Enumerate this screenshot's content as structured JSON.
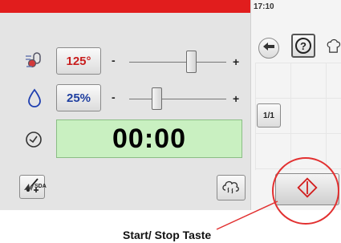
{
  "status_bar": {
    "time": "17:10"
  },
  "temperature": {
    "value": "125°",
    "minus": "-",
    "plus": "+",
    "slider_level": 0.66
  },
  "humidity": {
    "value": "25%",
    "minus": "-",
    "plus": "+",
    "slider_level": 0.26
  },
  "timer": {
    "value": "00:00"
  },
  "bottom": {
    "sda_label": "SDA"
  },
  "right_panel": {
    "page_indicator": "1/1",
    "help_label": "?"
  },
  "annotation": {
    "caption": "Start/ Stop Taste"
  },
  "colors": {
    "status_bar": "#e11d1d",
    "temperature_text": "#c81e1e",
    "humidity_text": "#1f3fa0",
    "timer_bg": "#c9f0c1",
    "highlight_circle": "#e23030"
  },
  "icons": [
    "thermometer-icon",
    "water-drop-icon",
    "clock-icon",
    "probe-add-icon",
    "sda-fan-icon",
    "steam-cloud-icon",
    "back-arrow-icon",
    "help-icon",
    "chef-hat-icon",
    "start-stop-icon"
  ]
}
